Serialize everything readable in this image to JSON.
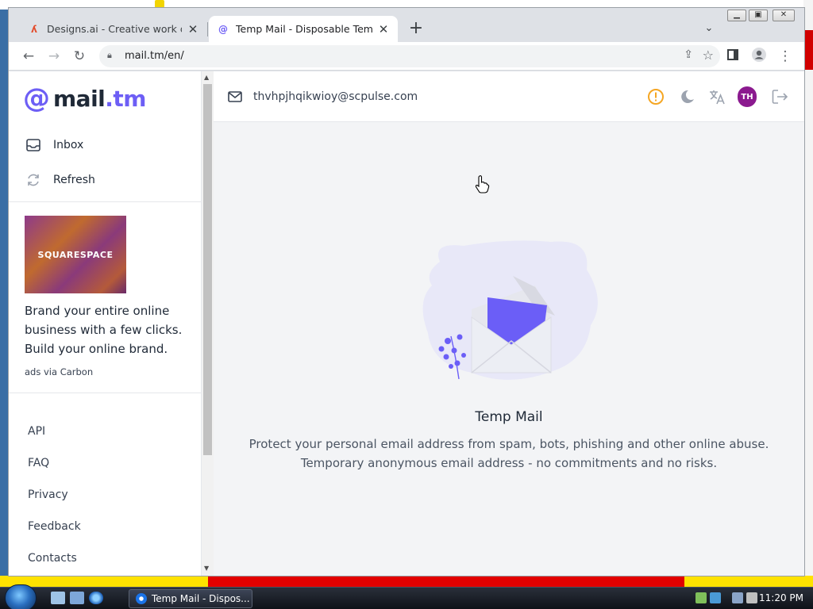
{
  "browser": {
    "tabs": [
      {
        "title": "Designs.ai - Creative work done q",
        "active": false,
        "favicon": "designs-ai-icon"
      },
      {
        "title": "Temp Mail - Disposable Tempora",
        "active": true,
        "favicon": "mail-tm-icon"
      }
    ],
    "url": "mail.tm/en/"
  },
  "sidebar": {
    "logo": {
      "at": "@",
      "mail": "mail",
      "tm": ".tm"
    },
    "nav": [
      {
        "label": "Inbox",
        "icon": "inbox-icon"
      },
      {
        "label": "Refresh",
        "icon": "refresh-icon"
      }
    ],
    "ad": {
      "brand": "SQUARESPACE",
      "text": "Brand your entire online business with a few clicks. Build your online brand.",
      "via": "ads via Carbon"
    },
    "footer_links": [
      "API",
      "FAQ",
      "Privacy",
      "Feedback",
      "Contacts"
    ]
  },
  "main": {
    "email_address": "thvhpjhqikwioy@scpulse.com",
    "avatar_initials": "TH",
    "empty_state": {
      "title": "Temp Mail",
      "line1": "Protect your personal email address from spam, bots, phishing and other online abuse.",
      "line2": "Temporary anonymous email address - no commitments and no risks."
    }
  },
  "taskbar": {
    "active_window": "Temp Mail - Dispos...",
    "clock": "11:20 PM"
  },
  "colors": {
    "accent": "#6d5ef5",
    "avatar": "#8b1a8f",
    "warning": "#f5a623"
  }
}
